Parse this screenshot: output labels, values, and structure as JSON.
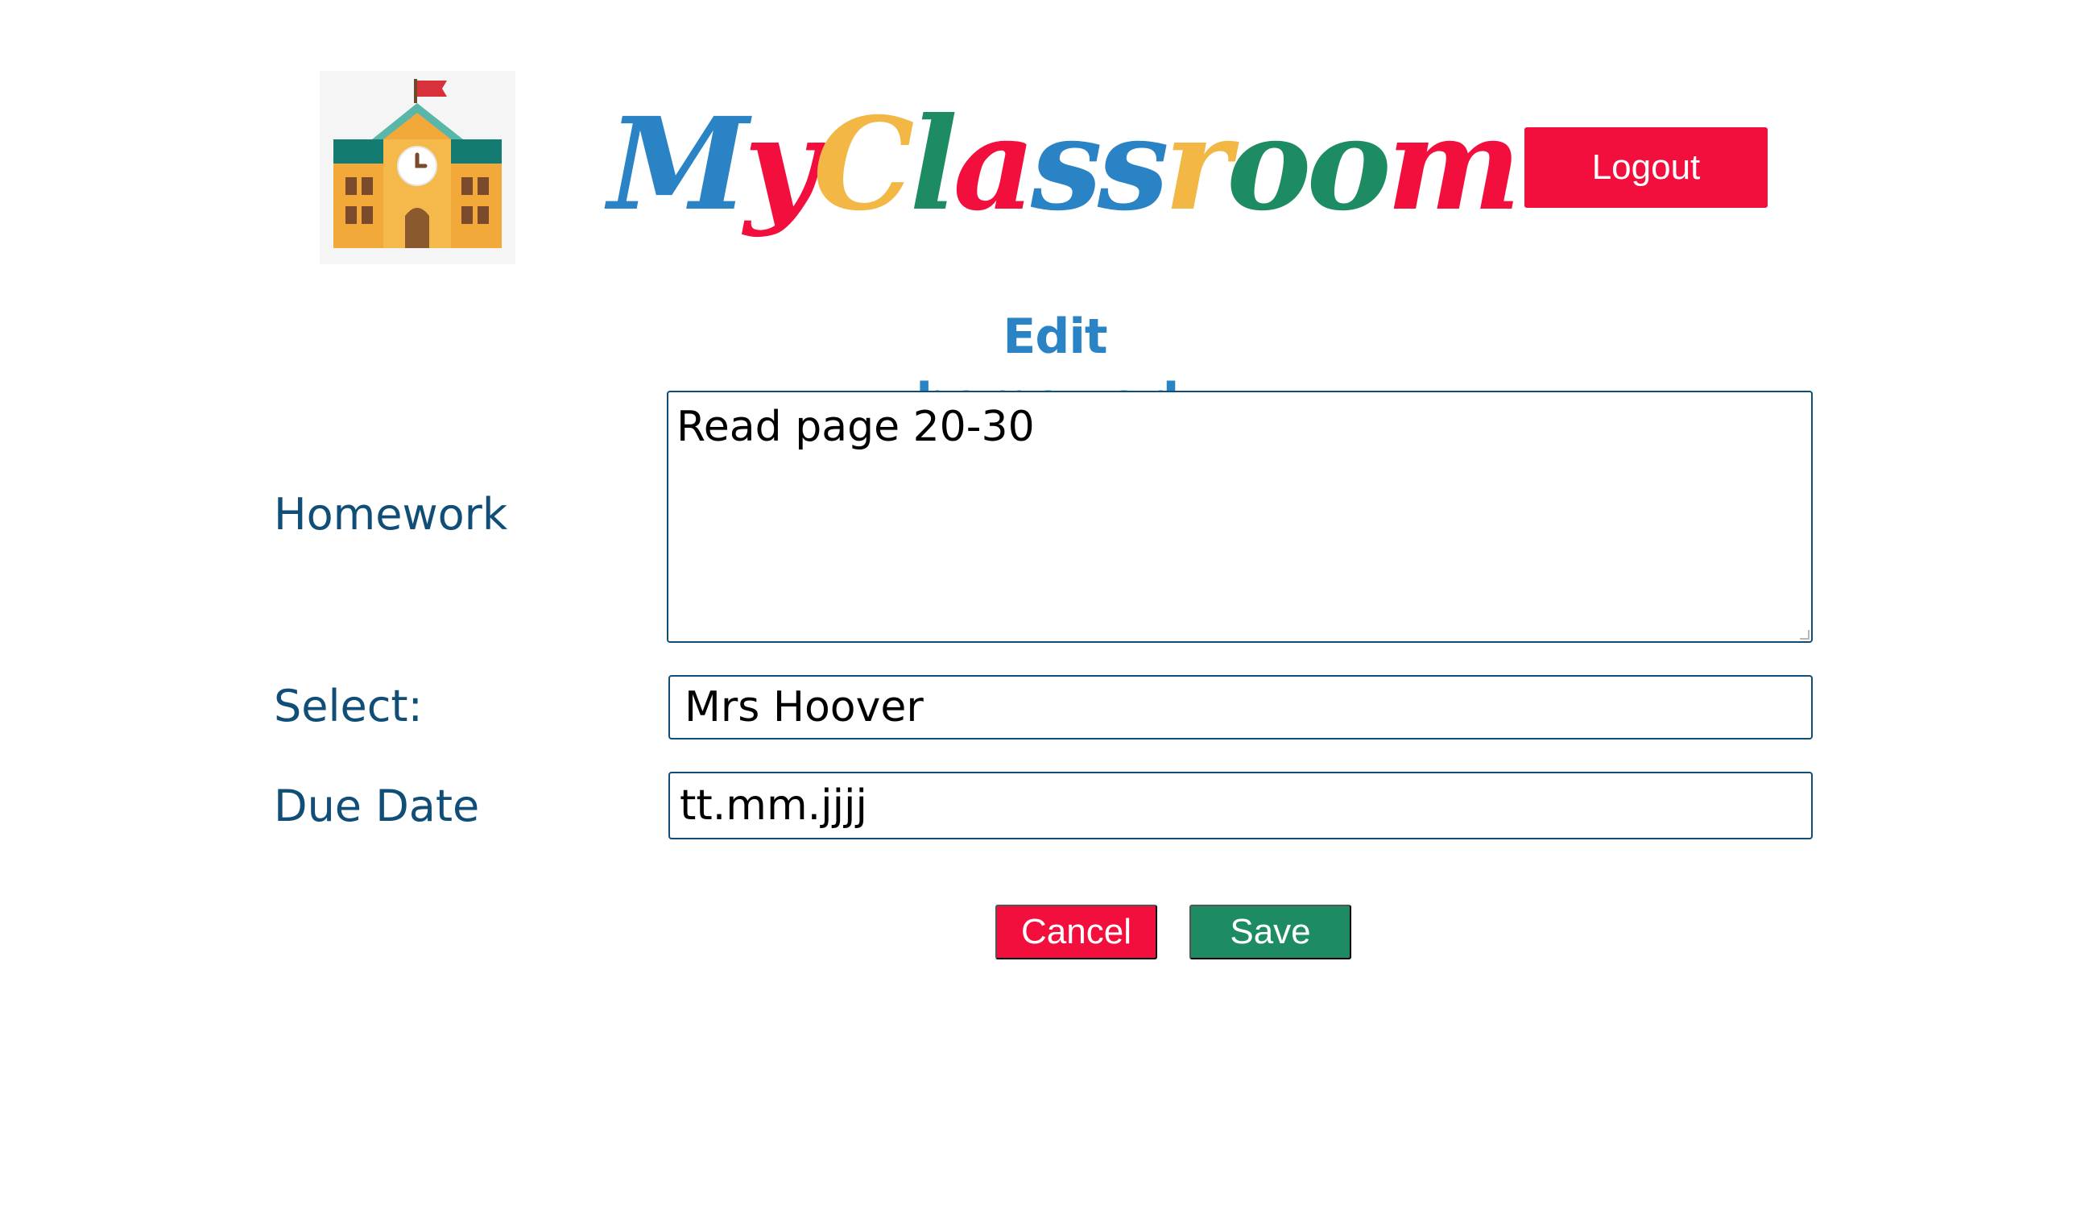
{
  "header": {
    "logo_icon": "school-building-icon",
    "brand_letters": [
      {
        "char": "M",
        "color": "#2a83c5"
      },
      {
        "char": "y",
        "color": "#f20f3d"
      },
      {
        "char": "C",
        "color": "#f2b744"
      },
      {
        "char": "l",
        "color": "#1e8c63"
      },
      {
        "char": "a",
        "color": "#f20f3d"
      },
      {
        "char": "s",
        "color": "#2a83c5"
      },
      {
        "char": "s",
        "color": "#2a83c5"
      },
      {
        "char": "r",
        "color": "#f2b744"
      },
      {
        "char": "o",
        "color": "#1e8c63"
      },
      {
        "char": "o",
        "color": "#1e8c63"
      },
      {
        "char": "m",
        "color": "#f20f3d"
      }
    ],
    "logout_label": "Logout"
  },
  "form": {
    "title": "Edit homework",
    "homework_label": "Homework",
    "homework_value": "Read page 20-30",
    "select_label": "Select:",
    "select_value": "Mrs Hoover",
    "due_date_label": "Due Date",
    "due_date_value": "tt.mm.jjjj",
    "cancel_label": "Cancel",
    "save_label": "Save"
  },
  "colors": {
    "primary_red": "#f20f3d",
    "primary_green": "#1e8c63",
    "primary_blue": "#2a83c5",
    "label_navy": "#104e78",
    "accent_yellow": "#f2b744"
  }
}
